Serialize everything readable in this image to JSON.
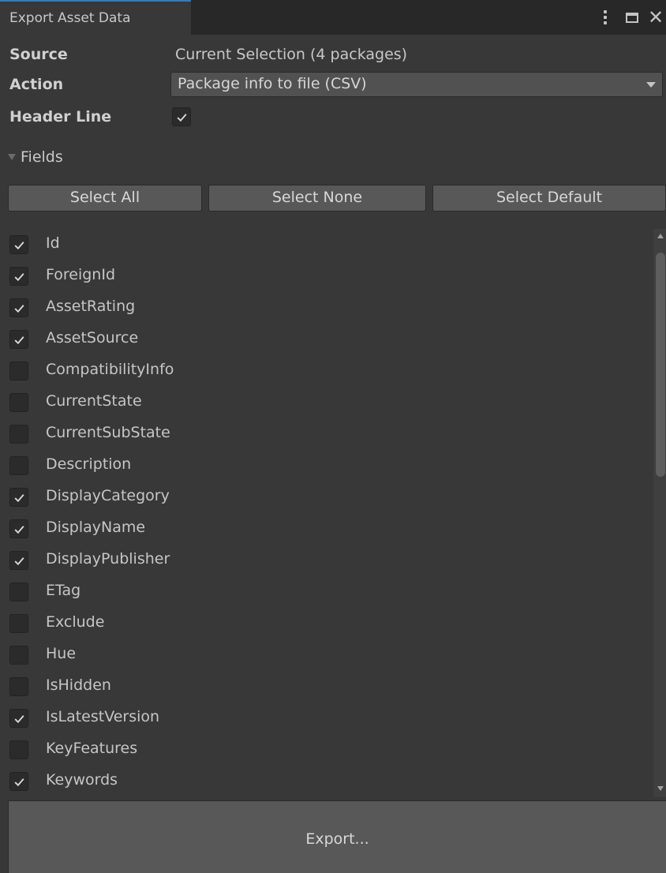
{
  "window": {
    "tab_title": "Export Asset Data",
    "menu_icon": "kebab-menu-icon",
    "maximize_icon": "maximize-icon",
    "close_icon": "close-icon",
    "close_glyph": "✕"
  },
  "source": {
    "label": "Source",
    "value": "Current Selection (4 packages)"
  },
  "action": {
    "label": "Action",
    "selected": "Package info to file (CSV)"
  },
  "header_line": {
    "label": "Header Line",
    "checked": true
  },
  "fields_foldout": {
    "label": "Fields",
    "expanded": true
  },
  "buttons": {
    "select_all": "Select All",
    "select_none": "Select None",
    "select_default": "Select Default"
  },
  "fields": [
    {
      "name": "Id",
      "checked": true
    },
    {
      "name": "ForeignId",
      "checked": true
    },
    {
      "name": "AssetRating",
      "checked": true
    },
    {
      "name": "AssetSource",
      "checked": true
    },
    {
      "name": "CompatibilityInfo",
      "checked": false
    },
    {
      "name": "CurrentState",
      "checked": false
    },
    {
      "name": "CurrentSubState",
      "checked": false
    },
    {
      "name": "Description",
      "checked": false
    },
    {
      "name": "DisplayCategory",
      "checked": true
    },
    {
      "name": "DisplayName",
      "checked": true
    },
    {
      "name": "DisplayPublisher",
      "checked": true
    },
    {
      "name": "ETag",
      "checked": false
    },
    {
      "name": "Exclude",
      "checked": false
    },
    {
      "name": "Hue",
      "checked": false
    },
    {
      "name": "IsHidden",
      "checked": false
    },
    {
      "name": "IsLatestVersion",
      "checked": true
    },
    {
      "name": "KeyFeatures",
      "checked": false
    },
    {
      "name": "Keywords",
      "checked": true
    }
  ],
  "export_button": "Export...",
  "colors": {
    "background": "#383838",
    "tab_bar": "#282828",
    "tab_accent": "#3a79bb",
    "button": "#585858",
    "checkbox": "#2b2b2b"
  }
}
